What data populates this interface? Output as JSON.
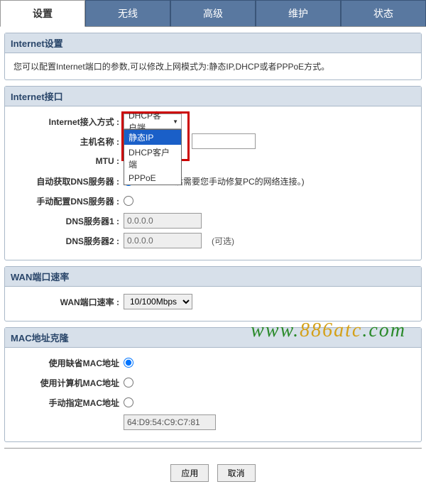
{
  "tabs": {
    "settings": "设置",
    "wireless": "无线",
    "advanced": "高级",
    "maintain": "维护",
    "status": "状态"
  },
  "internet_settings": {
    "title": "Internet设置",
    "intro": "您可以配置Internet端口的参数,可以修改上网模式为:静态IP,DHCP或者PPPoE方式。"
  },
  "internet_interface": {
    "title": "Internet接口",
    "labels": {
      "access_type": "Internet接入方式 :",
      "hostname": "主机名称 :",
      "mtu": "MTU :",
      "auto_dns": "自动获取DNS服务器 :",
      "manual_dns": "手动配置DNS服务器 :",
      "dns1": "DNS服务器1 :",
      "dns2": "DNS服务器2 :"
    },
    "dropdown": {
      "selected": "DHCP客户端",
      "options": {
        "static": "静态IP",
        "dhcp": "DHCP客户端",
        "pppoe": "PPPoE"
      }
    },
    "dns_hint": "置后需要您手动修复PC的网络连接。)",
    "dns1_value": "0.0.0.0",
    "dns2_value": "0.0.0.0",
    "optional_text": "(可选)"
  },
  "wan_rate": {
    "title": "WAN端口速率",
    "label": "WAN端口速率 :",
    "value": "10/100Mbps"
  },
  "mac_clone": {
    "title": "MAC地址克隆",
    "labels": {
      "use_default": "使用缺省MAC地址",
      "use_pc": "使用计算机MAC地址",
      "manual": "手动指定MAC地址"
    },
    "mac_value": "64:D9:54:C9:C7:81"
  },
  "buttons": {
    "apply": "应用",
    "cancel": "取消"
  },
  "watermark": {
    "w1": "www.",
    "w2": "886atc",
    "w3": ".com"
  }
}
